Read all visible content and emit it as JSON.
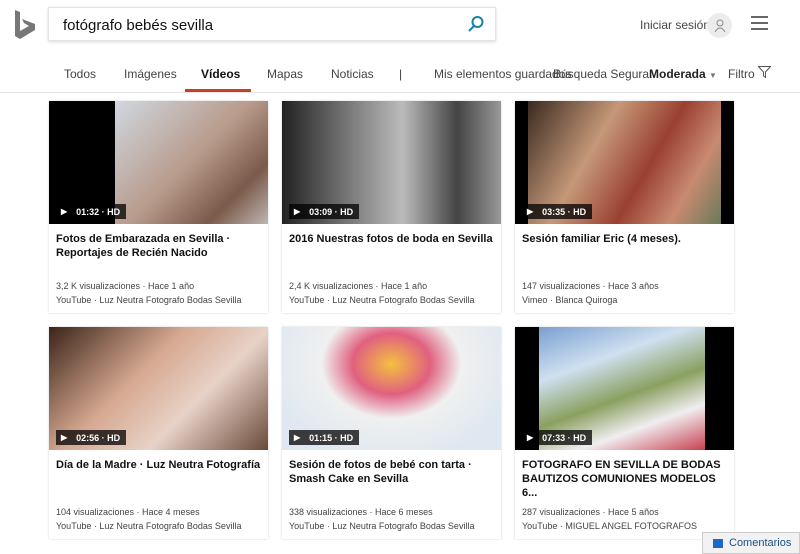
{
  "search": {
    "query": "fotógrafo bebés sevilla"
  },
  "header": {
    "signin": "Iniciar sesión"
  },
  "nav": {
    "items": [
      "Todos",
      "Imágenes",
      "Vídeos",
      "Mapas",
      "Noticias"
    ],
    "separator": "|",
    "saved": "Mis elementos guardados",
    "safe_label": "Búsqueda Segura:",
    "safe_value": "Moderada",
    "filter": "Filtro"
  },
  "colors": {
    "accent": "#c4402b",
    "search_icon": "#1b7fa6"
  },
  "videos": [
    {
      "duration": "01:32 · HD",
      "title": "Fotos de Embarazada en Sevilla · Reportajes de Recién Nacido",
      "stats": "3,2 K visualizaciones · Hace 1 año",
      "source": "YouTube · Luz Neutra Fotografo Bodas Sevilla"
    },
    {
      "duration": "03:09 · HD",
      "title": "2016 Nuestras fotos de boda en Sevilla",
      "stats": "2,4 K visualizaciones · Hace 1 año",
      "source": "YouTube · Luz Neutra Fotografo Bodas Sevilla"
    },
    {
      "duration": "03:35 · HD",
      "title": "Sesión familiar Eric (4 meses).",
      "stats": "147 visualizaciones · Hace 3 años",
      "source": "Vimeo · Blanca Quiroga"
    },
    {
      "duration": "02:56 · HD",
      "title": "Día de la Madre · Luz Neutra Fotografía",
      "stats": "104 visualizaciones · Hace 4 meses",
      "source": "YouTube · Luz Neutra Fotografo Bodas Sevilla"
    },
    {
      "duration": "01:15 · HD",
      "title": "Sesión de fotos de bebé con tarta · Smash Cake en Sevilla",
      "stats": "338 visualizaciones · Hace 6 meses",
      "source": "YouTube · Luz Neutra Fotografo Bodas Sevilla"
    },
    {
      "duration": "07:33 · HD",
      "title": "FOTOGRAFO EN SEVILLA DE BODAS BAUTIZOS COMUNIONES MODELOS 6...",
      "stats": "287 visualizaciones · Hace 5 años",
      "source": "YouTube · MIGUEL ANGEL FOTOGRAFOS"
    }
  ],
  "feedback": "Comentarios"
}
